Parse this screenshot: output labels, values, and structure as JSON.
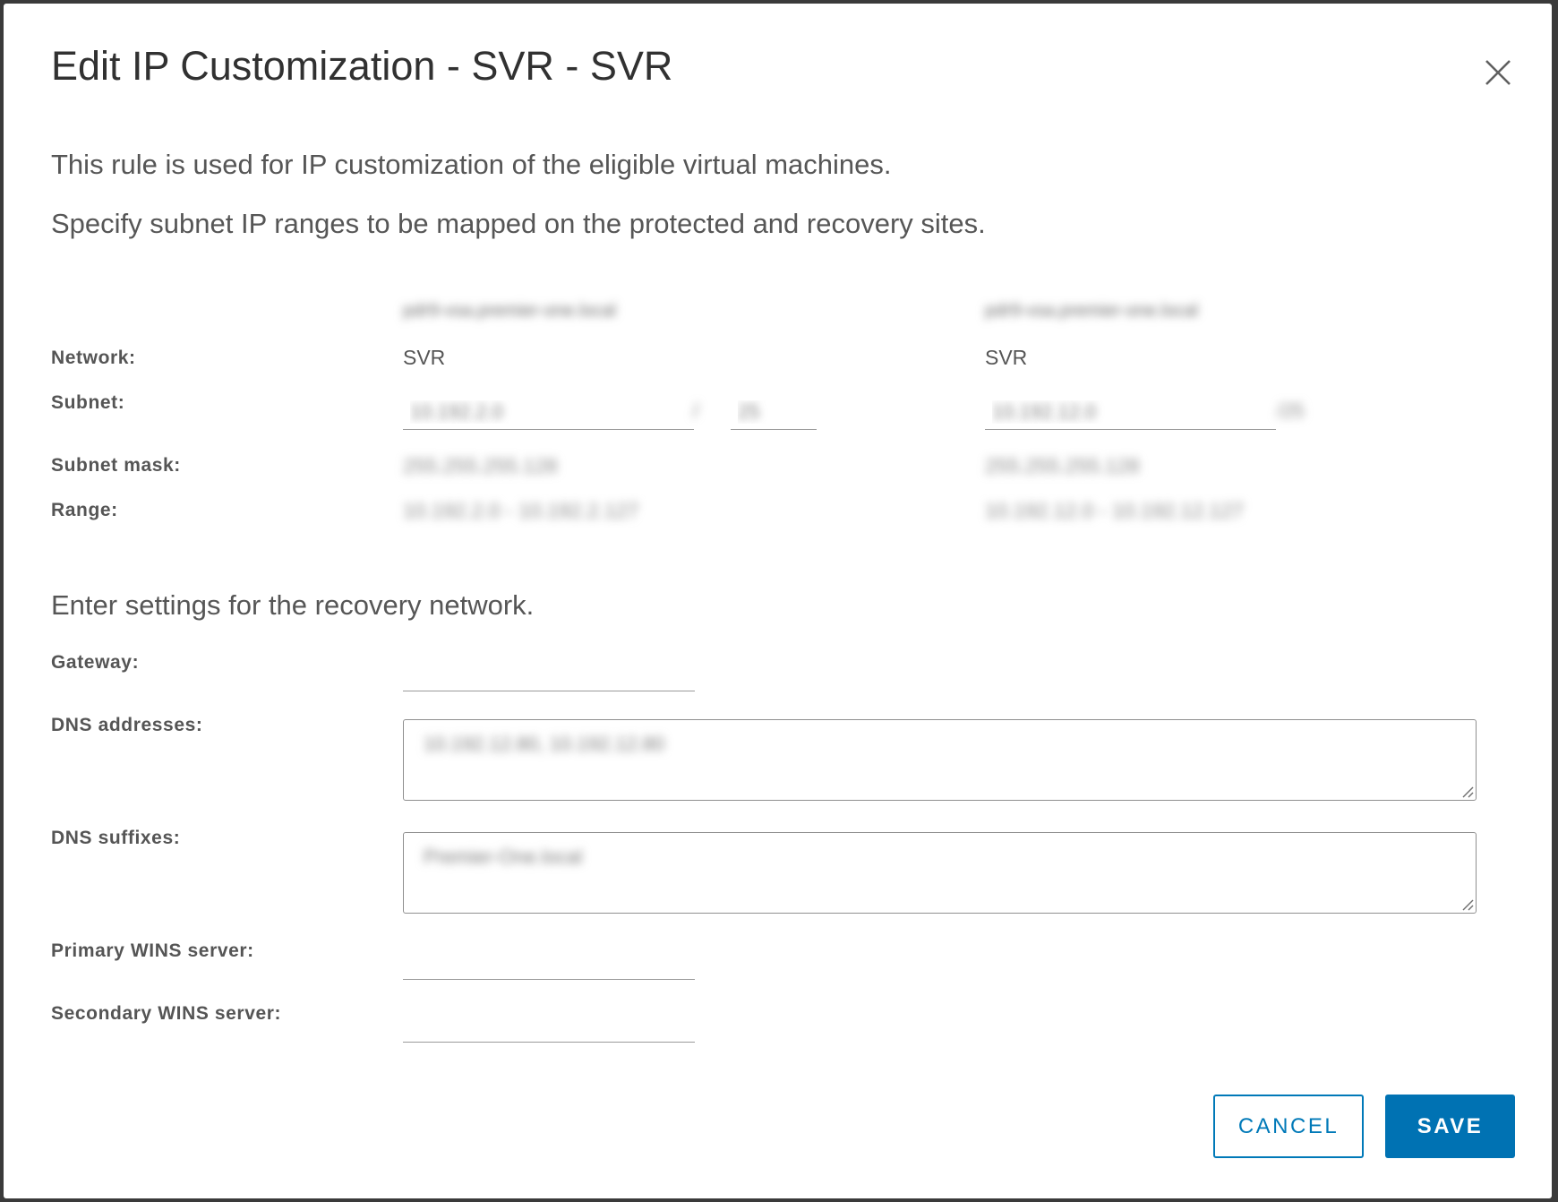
{
  "dialog": {
    "title": "Edit IP Customization - SVR - SVR",
    "intro_line1": "This rule is used for IP customization of the eligible virtual machines.",
    "intro_line2": "Specify subnet IP ranges to be mapped on the protected and recovery sites.",
    "section_recovery": "Enter settings for the recovery network."
  },
  "sites": {
    "protected": {
      "name": "pdr9-vsa.premier-one.local",
      "network": "SVR",
      "subnet_ip": "10.192.2.0",
      "subnet_prefix": "25",
      "subnet_mask": "255.255.255.128",
      "range": "10.192.2.0 - 10.192.2.127"
    },
    "recovery": {
      "name": "pdr9-vsa.premier-one.local",
      "network": "SVR",
      "subnet_ip": "10.192.12.0",
      "subnet_prefix": "/25",
      "subnet_mask": "255.255.255.128",
      "range": "10.192.12.0 - 10.192.12.127"
    }
  },
  "labels": {
    "network": "Network:",
    "subnet": "Subnet:",
    "subnet_mask": "Subnet mask:",
    "range": "Range:",
    "gateway": "Gateway:",
    "dns_addresses": "DNS addresses:",
    "dns_suffixes": "DNS suffixes:",
    "primary_wins": "Primary WINS server:",
    "secondary_wins": "Secondary WINS server:"
  },
  "recovery_settings": {
    "gateway": "",
    "dns_addresses": "10.192.12.80, 10.192.12.80",
    "dns_suffixes": "Premier-One.local",
    "primary_wins": "",
    "secondary_wins": ""
  },
  "buttons": {
    "cancel": "CANCEL",
    "save": "SAVE"
  },
  "colors": {
    "accent": "#0072b3",
    "cancel_border": "#0079b8",
    "backdrop": "#3a3a3a"
  }
}
